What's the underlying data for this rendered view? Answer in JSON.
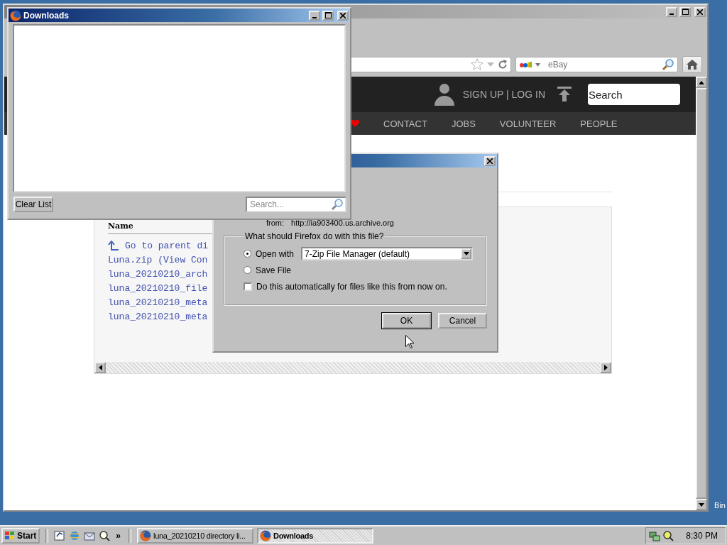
{
  "browser_window": {
    "nav": {
      "search_placeholder": "eBay"
    },
    "page": {
      "header": {
        "account_link": "SIGN UP | LOG IN",
        "search_value": "Search"
      },
      "nav_items": [
        "CONTACT",
        "JOBS",
        "VOLUNTEER",
        "PEOPLE"
      ],
      "listing": {
        "column_1": "Name",
        "rows": [
          {
            "kind": "parent",
            "label": "Go to parent di"
          },
          {
            "kind": "file",
            "label": "Luna.zip (View Con"
          },
          {
            "kind": "file",
            "label": "luna_20210210_arch"
          },
          {
            "kind": "file",
            "label": "luna_20210210_file"
          },
          {
            "kind": "file",
            "label": "luna_20210210_meta"
          },
          {
            "kind": "file",
            "label": "luna_20210210_meta"
          }
        ]
      }
    }
  },
  "dialog": {
    "source_label": "from:",
    "source_url": "http://ia903400.us.archive.org",
    "group_label": "What should Firefox do with this file?",
    "options": [
      {
        "label": "Open with",
        "selected": true
      },
      {
        "label": "Save File",
        "selected": false
      }
    ],
    "app_select": "7-Zip File Manager (default)",
    "auto_checkbox": {
      "label": "Do this automatically for files like this from now on.",
      "checked": false
    },
    "buttons": [
      "OK",
      "Cancel"
    ]
  },
  "downloads_window": {
    "title": "Downloads",
    "clear_button": "Clear List",
    "search_placeholder": "Search..."
  },
  "desktop": {
    "icon_label": "Bin"
  },
  "taskbar": {
    "start": "Start",
    "more": "»",
    "tasks": [
      {
        "label": "luna_20210210 directory li...",
        "selected": false
      },
      {
        "label": "Downloads",
        "selected": true
      }
    ],
    "clock": "8:30 PM"
  }
}
